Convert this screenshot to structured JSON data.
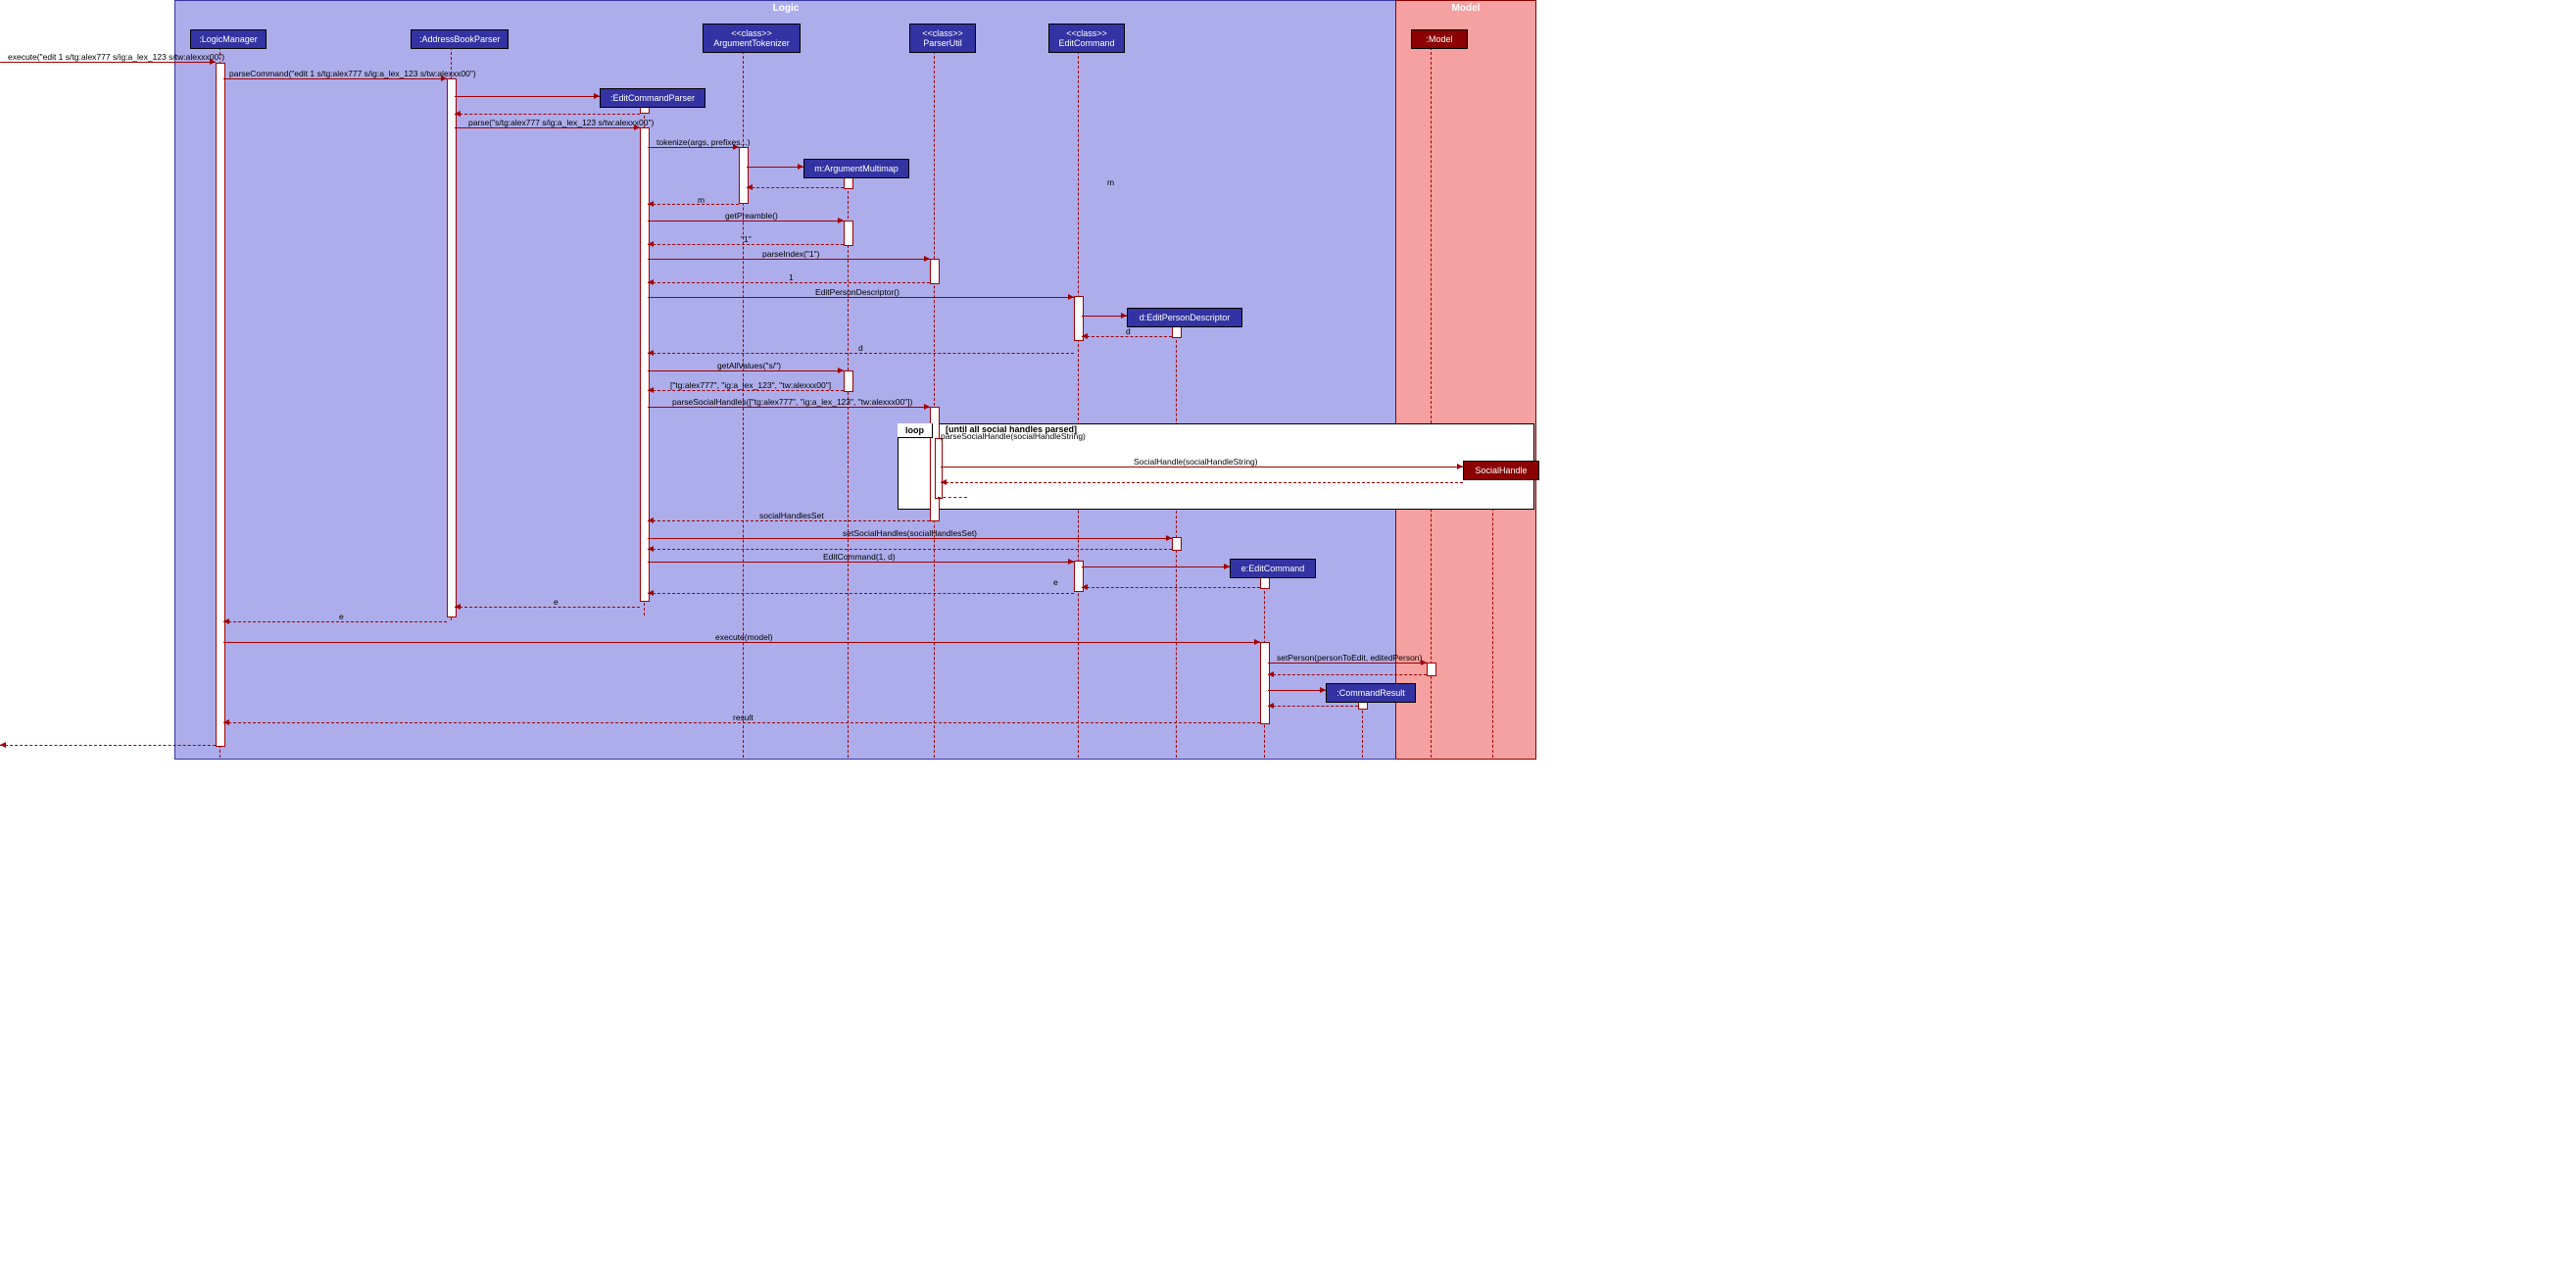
{
  "boxes": {
    "logic": "Logic",
    "model": "Model"
  },
  "participants": {
    "logicManager": ":LogicManager",
    "addressBookParser": ":AddressBookParser",
    "argumentTokenizer": {
      "stereo": "<<class>>",
      "name": "ArgumentTokenizer"
    },
    "parserUtil": {
      "stereo": "<<class>>",
      "name": "ParserUtil"
    },
    "editCommand": {
      "stereo": "<<class>>",
      "name": "EditCommand"
    },
    "modelP": ":Model",
    "editCommandParser": ":EditCommandParser",
    "argumentMultimap": "m:ArgumentMultimap",
    "editPersonDescriptor": "d:EditPersonDescriptor",
    "socialHandle": "SocialHandle",
    "eEditCommand": "e:EditCommand",
    "commandResult": ":CommandResult"
  },
  "messages": {
    "execute": "execute(\"edit 1 s/tg:alex777 s/ig:a_lex_123 s/tw:alexxx00\")",
    "parseCommand": "parseCommand(\"edit 1 s/tg:alex777 s/ig:a_lex_123 s/tw:alexxx00\")",
    "parse": "parse(\"s/tg:alex777 s/ig:a_lex_123 s/tw:alexxx00\")",
    "tokenize": "tokenize(args, prefixes...)",
    "returnM": "m",
    "returnM2": "m",
    "getPreamble": "getPreamble()",
    "return1str": "\"1\"",
    "parseIndex": "parseIndex(\"1\")",
    "return1": "1",
    "editPersonDesc": "EditPersonDescriptor()",
    "returnD": "d",
    "getAllValues": "getAllValues(\"s/\")",
    "returnList": "[\"tg:alex777\", \"ig:a_lex_123\", \"tw:alexxx00\"]",
    "parseSocialHandles": "parseSocialHandles([\"tg:alex777\", \"ig:a_lex_123\", \"tw:alexxx00\"])",
    "parseSocialHandle": "parseSocialHandle(socialHandleString)",
    "socialHandleCtor": "SocialHandle(socialHandleString)",
    "socialHandlesSet": "socialHandlesSet",
    "setSocialHandles": "setSocialHandles(socialHandlesSet)",
    "editCommandCtor": "EditCommand(1, d)",
    "returnE": "e",
    "returnE2": "e",
    "returnE3": "e",
    "executeModel": "execute(model)",
    "setPerson": "setPerson(personToEdit, editedPerson)",
    "result": "result"
  },
  "loop": {
    "label": "loop",
    "condition": "[until all social handles parsed]"
  }
}
